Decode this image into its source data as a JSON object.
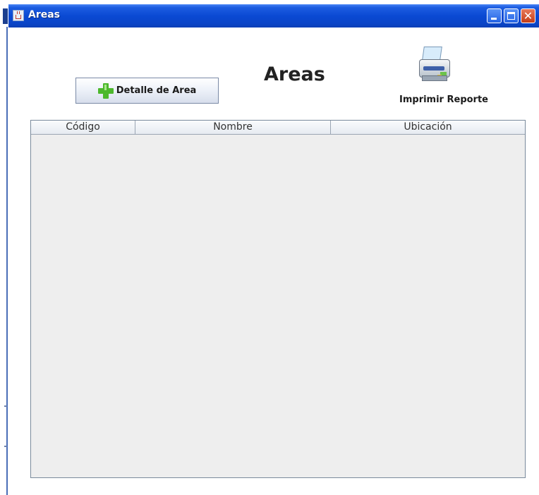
{
  "window": {
    "title": "Areas"
  },
  "toolbar": {
    "detalle_label": "Detalle de Area",
    "print_label": "Imprimir Reporte"
  },
  "page": {
    "title": "Areas"
  },
  "table": {
    "columns": [
      "Código",
      "Nombre",
      "Ubicación"
    ],
    "rows": []
  }
}
